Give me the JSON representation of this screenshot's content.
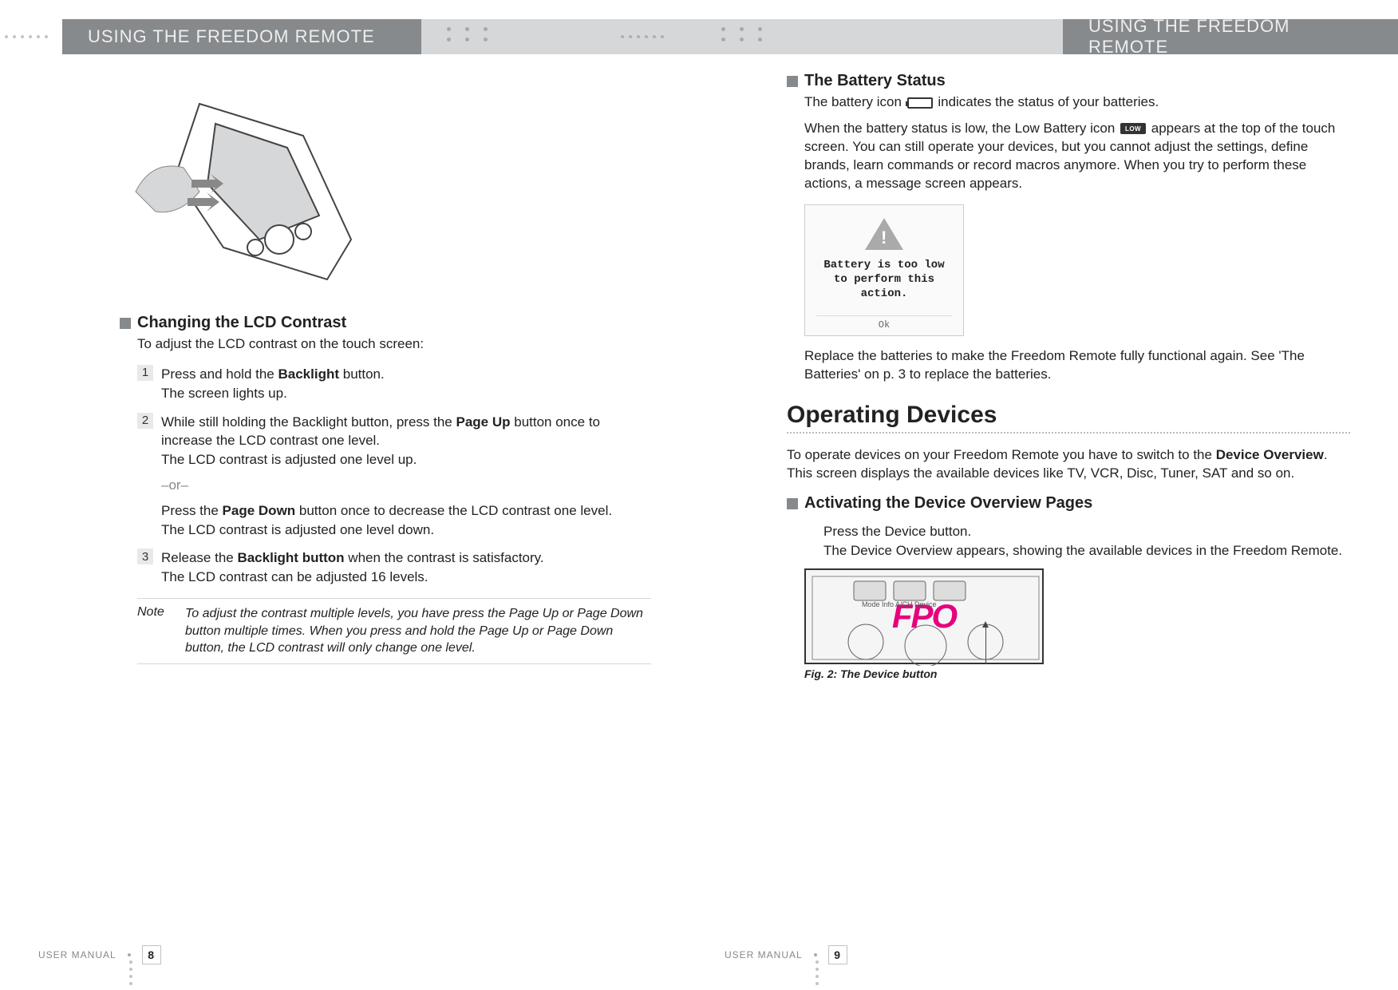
{
  "header": {
    "left_title": "USING THE FREEDOM REMOTE",
    "right_title": "USING THE FREEDOM REMOTE"
  },
  "left_page": {
    "section1": {
      "heading": "Changing the LCD Contrast",
      "intro": "To adjust the LCD contrast on the touch screen:",
      "steps": [
        {
          "num": "1",
          "main_pre": "Press and hold the ",
          "bold1": "Backlight",
          "main_post": " button.",
          "sub": "The screen lights up."
        },
        {
          "num": "2",
          "main_pre": "While still holding the Backlight button, press the ",
          "bold1": "Page Up",
          "main_post": " button once to increase the LCD contrast one level.",
          "sub": "The LCD contrast is adjusted one level up.",
          "or": "–or–",
          "main2_pre": "Press the ",
          "bold2": "Page Down",
          "main2_post": " button once to decrease the LCD contrast one level.",
          "sub2": "The LCD contrast is adjusted one level down."
        },
        {
          "num": "3",
          "main_pre": "Release the ",
          "bold1": "Backlight button",
          "main_post": " when the contrast is satisfactory.",
          "sub": "The LCD contrast can be adjusted 16 levels."
        }
      ],
      "note_label": "Note",
      "note_text": "To adjust the contrast multiple levels, you have press the Page Up or Page Down button multiple times. When you press and hold the Page Up or Page Down button, the LCD contrast will only change one level."
    },
    "footer_label": "USER MANUAL",
    "page_num": "8"
  },
  "right_page": {
    "section1": {
      "heading": "The Battery Status",
      "p1_pre": "The battery icon ",
      "p1_post": " indicates the status of your batteries.",
      "p2_pre": "When the battery status is low, the Low Battery icon ",
      "p2_post": " appears at the top of the touch screen. You can still operate your devices, but you cannot adjust the settings, define brands, learn commands or record macros anymore. When you try to perform these actions, a message screen appears.",
      "screen_msg": "Battery is too low to perform this action.",
      "screen_ok": "Ok",
      "p3": "Replace the batteries to make the Freedom Remote fully functional again. See 'The Batteries' on p. 3 to replace the batteries."
    },
    "big_heading": "Operating Devices",
    "intro2_pre": "To operate devices on your Freedom Remote you have to switch to the ",
    "intro2_bold": "Device Overview",
    "intro2_post": ". This screen displays the available devices like TV, VCR, Disc, Tuner, SAT and so on.",
    "section2": {
      "heading": "Activating the Device Overview Pages",
      "step_main": "Press the Device button.",
      "step_sub": "The Device Overview appears, showing the available devices in the Freedom Remote.",
      "fpo": "FPO",
      "fig_label": "Fig. 2: The Device button"
    },
    "footer_label": "USER MANUAL",
    "page_num": "9"
  }
}
